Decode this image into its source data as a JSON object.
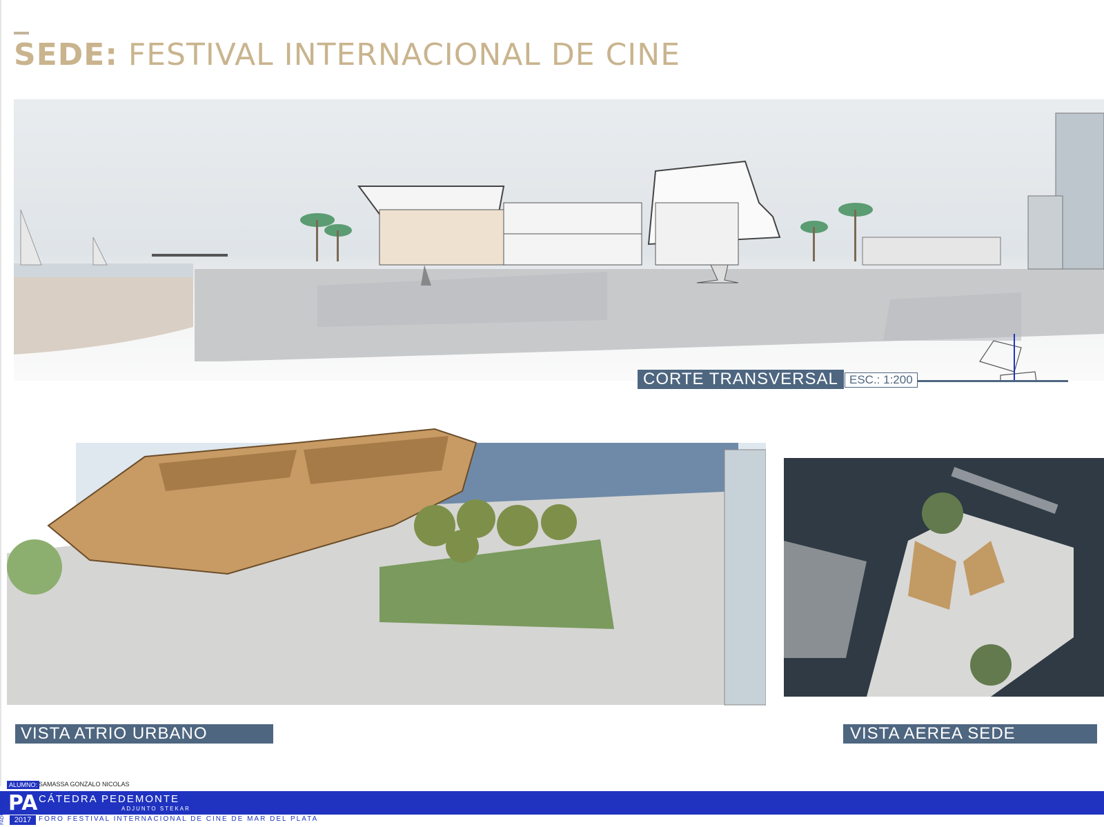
{
  "title": {
    "bold": "SEDE:",
    "rest": " FESTIVAL INTERNACIONAL DE CINE"
  },
  "section": {
    "label": "CORTE TRANSVERSAL",
    "scale": "ESC.: 1:200"
  },
  "views": {
    "atrio_label": "VISTA ATRIO URBANO",
    "aerea_label": "VISTA AEREA  SEDE"
  },
  "footer": {
    "alumno_tag": "ALUMNO:",
    "alumno_name": "SAMASSA GONZALO NICOLAS",
    "side_text": "FADU/UBA",
    "logo": "PA",
    "year": "2017",
    "catedra": "CÁTEDRA PEDEMONTE",
    "adjunto": "ADJUNTO STEKAR",
    "foro": "FORO FESTIVAL INTERNACIONAL DE CINE DE MAR DEL PLATA",
    "colors": {
      "band": "#1f33c0",
      "accent": "#4e6680",
      "title": "#c9b48e"
    }
  }
}
